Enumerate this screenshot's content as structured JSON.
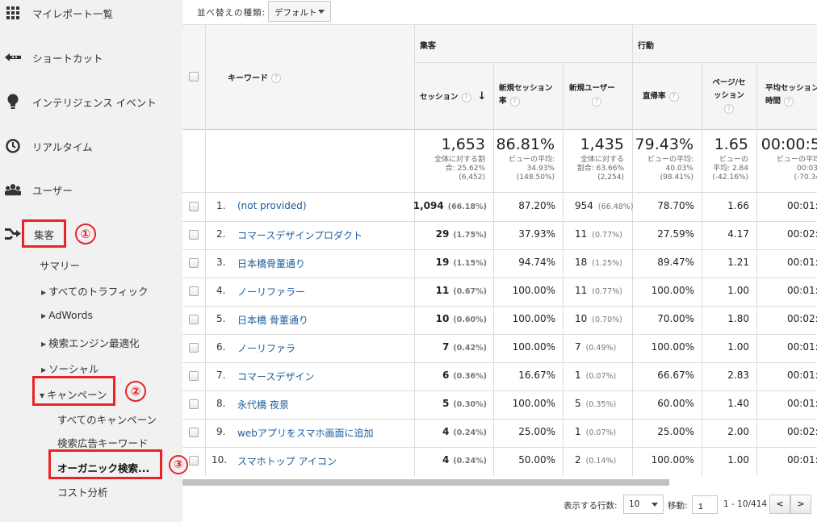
{
  "sidebar": {
    "items": [
      {
        "label": "マイレポート一覧",
        "icon": "grid-icon"
      },
      {
        "label": "ショートカット",
        "icon": "shortcut-arrow-icon"
      },
      {
        "label": "インテリジェンス イベント",
        "icon": "lightbulb-icon"
      },
      {
        "label": "リアルタイム",
        "icon": "clock-icon"
      },
      {
        "label": "ユーザー",
        "icon": "users-icon"
      },
      {
        "label": "集客",
        "icon": "acquisition-icon"
      }
    ],
    "summary": "サマリー",
    "sub": [
      "すべてのトラフィック",
      "AdWords",
      "検索エンジン最適化",
      "ソーシャル",
      "キャンペーン"
    ],
    "campaign_sub": [
      "すべてのキャンペーン",
      "検索広告キーワード",
      "オーガニック検索...",
      "コスト分析"
    ],
    "annotations": [
      "①",
      "②",
      "③"
    ]
  },
  "toolbar": {
    "sort_label": "並べ替えの種類:",
    "sort_value": "デフォルト"
  },
  "table": {
    "dimension_header": "キーワード",
    "groups": [
      "集客",
      "行動"
    ],
    "columns": [
      "セッション",
      "新規セッション率",
      "新規ユーザー",
      "直帰率",
      "ページ/セッション",
      "平均セッション時間"
    ],
    "column_lines": [
      [
        "セッション"
      ],
      [
        "新規セッション",
        "率"
      ],
      [
        "新規ユーザー"
      ],
      [
        "直帰率"
      ],
      [
        "ページ/セ",
        "ッション"
      ],
      [
        "平均セッション",
        "時間"
      ]
    ],
    "sort_arrow": "↓",
    "totals": [
      {
        "value": "1,653",
        "lines": [
          "全体に対する割",
          "合: 25.62%",
          "(6,452)"
        ]
      },
      {
        "value": "86.81%",
        "lines": [
          "ビューの平均:",
          "34.93%",
          "(148.50%)"
        ]
      },
      {
        "value": "1,435",
        "lines": [
          "全体に対する",
          "割合: 63.66%",
          "(2,254)"
        ]
      },
      {
        "value": "79.43%",
        "lines": [
          "ビューの平均:",
          "40.03%",
          "(98.41%)"
        ]
      },
      {
        "value": "1.65",
        "lines": [
          "ビューの",
          "平均: 2.84",
          "(-42.16%)"
        ]
      },
      {
        "value": "00:00:5",
        "lines": [
          "ビューの平均",
          "00:03:",
          "(-70.34"
        ]
      }
    ],
    "rows": [
      {
        "n": "1.",
        "kw": "(not provided)",
        "sessions": "1,094",
        "sess_pct": "(66.18%)",
        "new_rate": "87.20%",
        "new_users": "954",
        "nu_pct": "(66.48%)",
        "bounce": "78.70%",
        "pps": "1.66",
        "dur": "00:01:"
      },
      {
        "n": "2.",
        "kw": "コマースデザインプロダクト",
        "sessions": "29",
        "sess_pct": "(1.75%)",
        "new_rate": "37.93%",
        "new_users": "11",
        "nu_pct": "(0.77%)",
        "bounce": "27.59%",
        "pps": "4.17",
        "dur": "00:02:"
      },
      {
        "n": "3.",
        "kw": "日本橋骨董通り",
        "sessions": "19",
        "sess_pct": "(1.15%)",
        "new_rate": "94.74%",
        "new_users": "18",
        "nu_pct": "(1.25%)",
        "bounce": "89.47%",
        "pps": "1.21",
        "dur": "00:01:"
      },
      {
        "n": "4.",
        "kw": "ノーリファラー",
        "sessions": "11",
        "sess_pct": "(0.67%)",
        "new_rate": "100.00%",
        "new_users": "11",
        "nu_pct": "(0.77%)",
        "bounce": "100.00%",
        "pps": "1.00",
        "dur": "00:01:"
      },
      {
        "n": "5.",
        "kw": "日本橋 骨董通り",
        "sessions": "10",
        "sess_pct": "(0.60%)",
        "new_rate": "100.00%",
        "new_users": "10",
        "nu_pct": "(0.70%)",
        "bounce": "70.00%",
        "pps": "1.80",
        "dur": "00:02:"
      },
      {
        "n": "6.",
        "kw": "ノーリファラ",
        "sessions": "7",
        "sess_pct": "(0.42%)",
        "new_rate": "100.00%",
        "new_users": "7",
        "nu_pct": "(0.49%)",
        "bounce": "100.00%",
        "pps": "1.00",
        "dur": "00:01:"
      },
      {
        "n": "7.",
        "kw": "コマースデザイン",
        "sessions": "6",
        "sess_pct": "(0.36%)",
        "new_rate": "16.67%",
        "new_users": "1",
        "nu_pct": "(0.07%)",
        "bounce": "66.67%",
        "pps": "2.83",
        "dur": "00:01:"
      },
      {
        "n": "8.",
        "kw": "永代橋 夜景",
        "sessions": "5",
        "sess_pct": "(0.30%)",
        "new_rate": "100.00%",
        "new_users": "5",
        "nu_pct": "(0.35%)",
        "bounce": "60.00%",
        "pps": "1.40",
        "dur": "00:01:"
      },
      {
        "n": "9.",
        "kw": "webアプリをスマホ画面に追加",
        "sessions": "4",
        "sess_pct": "(0.24%)",
        "new_rate": "25.00%",
        "new_users": "1",
        "nu_pct": "(0.07%)",
        "bounce": "25.00%",
        "pps": "2.00",
        "dur": "00:02:"
      },
      {
        "n": "10.",
        "kw": "スマホトップ アイコン",
        "sessions": "4",
        "sess_pct": "(0.24%)",
        "new_rate": "50.00%",
        "new_users": "2",
        "nu_pct": "(0.14%)",
        "bounce": "100.00%",
        "pps": "1.00",
        "dur": "00:01:"
      }
    ]
  },
  "pager": {
    "rows_label": "表示する行数:",
    "rows_value": "10",
    "goto_label": "移動:",
    "goto_value": "1",
    "range": "1 - 10/414",
    "prev": "<",
    "next": ">"
  },
  "colors": {
    "accent_red": "#e8242a",
    "link_blue": "#1a5c9e",
    "sidebar_bg": "#f1f1f1"
  }
}
